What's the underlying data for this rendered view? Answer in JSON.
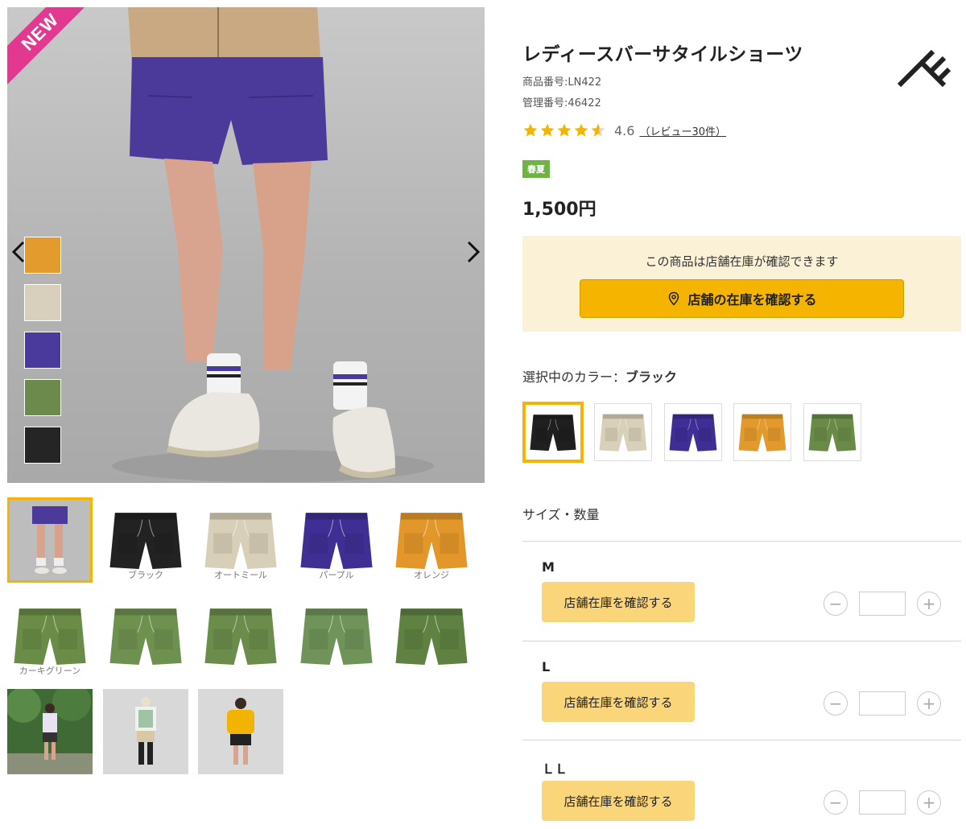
{
  "gallery": {
    "badge": "NEW",
    "mini_swatches": [
      {
        "color": "#e39b2e",
        "name": "orange"
      },
      {
        "color": "#d8d0bc",
        "name": "oatmeal"
      },
      {
        "color": "#4a3a9c",
        "name": "purple"
      },
      {
        "color": "#6b8a4c",
        "name": "khaki-green"
      },
      {
        "color": "#252525",
        "name": "black"
      }
    ],
    "thumbnails": [
      {
        "label": "",
        "kind": "model-photo"
      },
      {
        "label": "ブラック",
        "color": "#222222"
      },
      {
        "label": "オートミール",
        "color": "#d8cfb8"
      },
      {
        "label": "パープル",
        "color": "#3f2f94"
      },
      {
        "label": "オレンジ",
        "color": "#e3962a"
      },
      {
        "label": "カーキグリーン",
        "color": "#6a8c46"
      },
      {
        "label": "",
        "color": "#6f9150"
      },
      {
        "label": "",
        "color": "#6b8c4b"
      },
      {
        "label": "",
        "color": "#6f9358"
      },
      {
        "label": "",
        "color": "#5f8243"
      },
      {
        "label": "",
        "kind": "forest"
      },
      {
        "label": "",
        "kind": "studio-1"
      },
      {
        "label": "",
        "kind": "studio-2"
      }
    ]
  },
  "product": {
    "title": "レディースバーサタイルショーツ",
    "product_number": "商品番号:LN422",
    "management_number": "管理番号:46422",
    "rating_value": "4.6",
    "rating": 4.6,
    "review_link": "（レビュー30件）",
    "season_badge": "春夏",
    "price": "1,500円"
  },
  "store": {
    "message": "この商品は店舗在庫が確認できます",
    "button_label": "店舗の在庫を確認する",
    "icon": "map-pin-icon"
  },
  "colors": {
    "label_prefix": "選択中のカラー：",
    "selected_name": "ブラック",
    "options": [
      {
        "name": "black",
        "color": "#1f1f1f"
      },
      {
        "name": "oatmeal",
        "color": "#d9d0ba"
      },
      {
        "name": "purple",
        "color": "#3e2e95"
      },
      {
        "name": "orange",
        "color": "#e39a2c"
      },
      {
        "name": "khaki-green",
        "color": "#6a8b48"
      }
    ]
  },
  "sizes": {
    "heading": "サイズ・数量",
    "rows": [
      {
        "size": "M",
        "button_label": "店舗在庫を確認する",
        "qty": ""
      },
      {
        "size": "L",
        "button_label": "店舗在庫を確認する",
        "qty": ""
      },
      {
        "size": "ＬＬ",
        "button_label": "店舗在庫を確認する",
        "qty": ""
      }
    ],
    "minus": "−",
    "plus": "+"
  },
  "theme": {
    "accent": "#f5b400",
    "store_bg": "#fbf1d6",
    "size_button": "#fad57a",
    "season_badge": "#6cb542",
    "new_badge": "#e3388f"
  }
}
